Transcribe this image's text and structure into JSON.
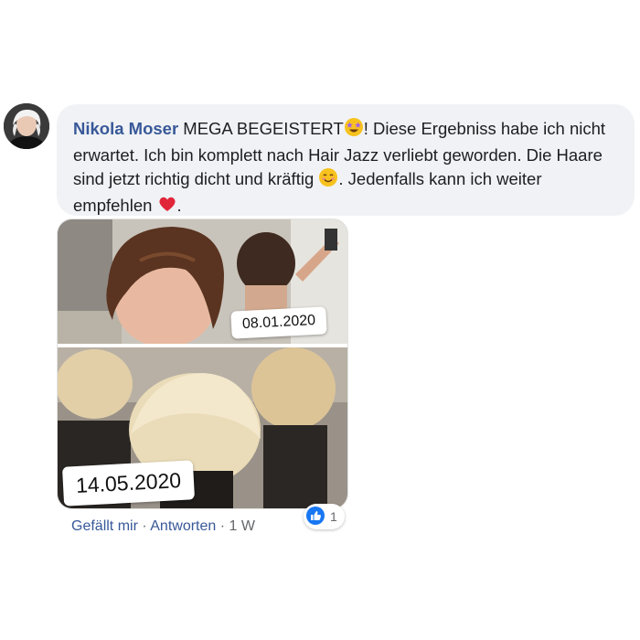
{
  "comment": {
    "author": "Nikola Moser",
    "text_1": " MEGA BEGEISTERT",
    "text_2": "! Diese Ergebniss habe ich nicht erwartet. Ich bin komplett nach Hair Jazz verliebt geworden. Die Haare sind jetzt richtig dicht und kräftig ",
    "text_3": ". Jedenfalls kann ich weiter empfehlen ",
    "text_4": "."
  },
  "photo": {
    "date_before": "08.01.2020",
    "date_after": "14.05.2020"
  },
  "actions": {
    "like_label": "Gefällt mir",
    "separator": " · ",
    "reply_label": "Antworten",
    "age": "1 W"
  },
  "reactions": {
    "count": "1",
    "icon": "thumbs-up-icon"
  },
  "colors": {
    "author": "#385898",
    "bubble": "#f0f2f5",
    "like_blue": "#1877f2"
  }
}
